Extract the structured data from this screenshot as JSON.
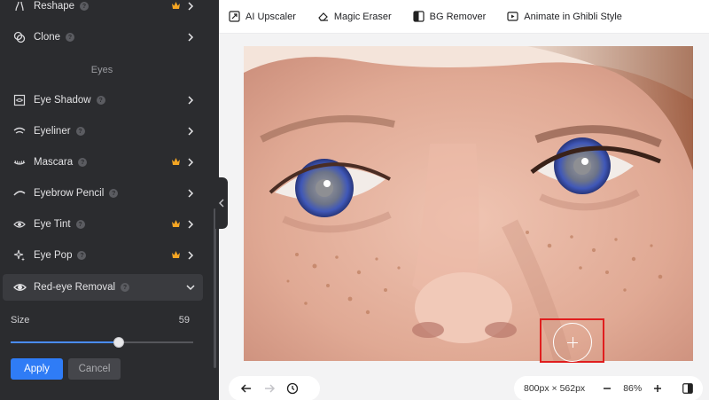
{
  "sidebar": {
    "items_top": [
      {
        "label": "Reshape",
        "premium": true,
        "icon": "reshape-icon"
      },
      {
        "label": "Clone",
        "premium": false,
        "icon": "clone-icon"
      }
    ],
    "section": "Eyes",
    "items_eyes": [
      {
        "label": "Eye Shadow",
        "premium": false,
        "icon": "eye-shadow-icon"
      },
      {
        "label": "Eyeliner",
        "premium": false,
        "icon": "eyeliner-icon"
      },
      {
        "label": "Mascara",
        "premium": true,
        "icon": "mascara-icon"
      },
      {
        "label": "Eyebrow Pencil",
        "premium": false,
        "icon": "eyebrow-pencil-icon"
      },
      {
        "label": "Eye Tint",
        "premium": true,
        "icon": "eye-tint-icon"
      },
      {
        "label": "Eye Pop",
        "premium": true,
        "icon": "eye-pop-icon"
      }
    ],
    "active_item": {
      "label": "Red-eye Removal",
      "icon": "red-eye-icon"
    },
    "size_label": "Size",
    "size_value": "59",
    "size_fraction": 0.59,
    "apply_label": "Apply",
    "cancel_label": "Cancel"
  },
  "toolbar": {
    "tools": [
      {
        "label": "AI Upscaler",
        "icon": "upscaler-icon"
      },
      {
        "label": "Magic Eraser",
        "icon": "eraser-icon"
      },
      {
        "label": "BG Remover",
        "icon": "bg-remover-icon"
      },
      {
        "label": "Animate in Ghibli Style",
        "icon": "animate-icon"
      }
    ]
  },
  "footer": {
    "dimensions": "800px × 562px",
    "zoom": "86%"
  },
  "colors": {
    "accent": "#2f7cf6",
    "premium": "#f5a623",
    "highlight": "#e01e1e"
  }
}
